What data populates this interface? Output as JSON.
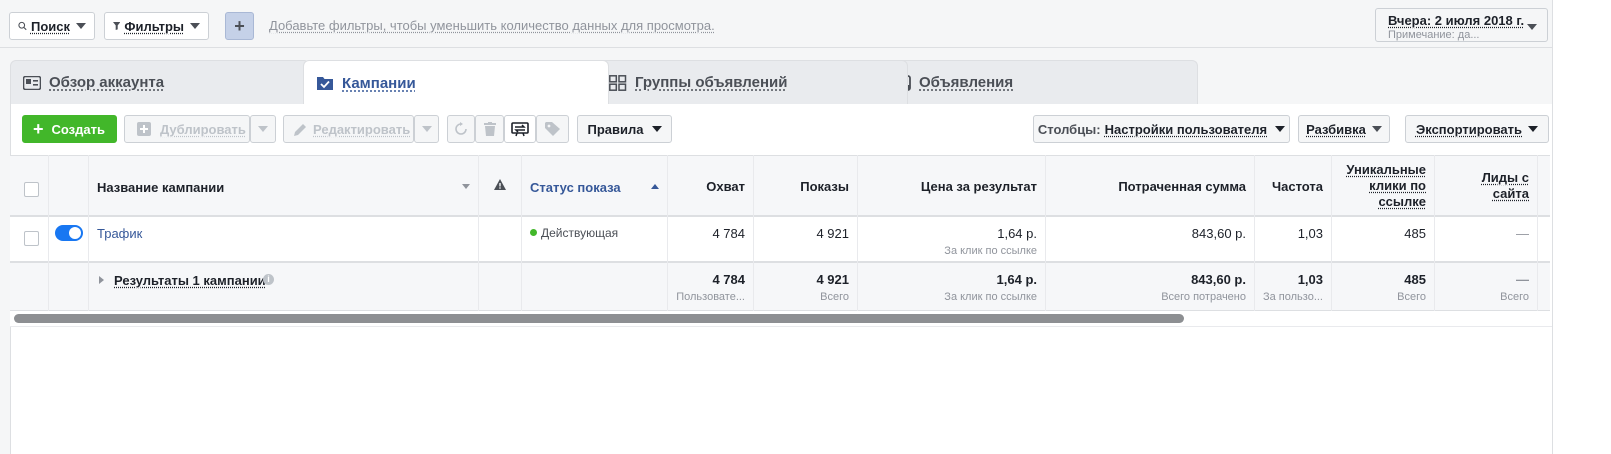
{
  "topbar": {
    "search_label": "Поиск",
    "filters_label": "Фильтры",
    "add_label": "+",
    "hint": "Добавьте фильтры, чтобы уменьшить количество данных для просмотра.",
    "date_label": "Вчера: 2 июля 2018 г.",
    "date_note": "Примечание: да..."
  },
  "tabs": [
    {
      "label": "Обзор аккаунта",
      "icon": "account-overview-icon"
    },
    {
      "label": "Кампании",
      "icon": "campaigns-icon"
    },
    {
      "label": "Группы объявлений",
      "icon": "ad-sets-icon"
    },
    {
      "label": "Объявления",
      "icon": "ads-icon"
    }
  ],
  "toolbar": {
    "create": "Создать",
    "duplicate": "Дублировать",
    "edit": "Редактировать",
    "rules": "Правила",
    "columns_prefix": "Столбцы:",
    "columns_value": "Настройки пользователя",
    "breakdown": "Разбивка",
    "export": "Экспортировать"
  },
  "columns": {
    "name": "Название кампании",
    "status": "Статус показа",
    "reach": "Охват",
    "impressions": "Показы",
    "cost": "Цена за результат",
    "spent": "Потраченная сумма",
    "frequency": "Частота",
    "unique_clicks": "Уникальные клики по ссылке",
    "leads": "Лиды с сайта"
  },
  "row": {
    "name": "Трафик",
    "status": "Действующая",
    "reach": "4 784",
    "impressions": "4 921",
    "cost": "1,64 р.",
    "cost_sub": "За клик по ссылке",
    "spent": "843,60 р.",
    "frequency": "1,03",
    "unique_clicks": "485",
    "leads": "—"
  },
  "totals": {
    "label": "Результаты 1 кампании",
    "reach": "4 784",
    "reach_sub": "Пользовате...",
    "impressions": "4 921",
    "impressions_sub": "Всего",
    "cost": "1,64 р.",
    "cost_sub": "За клик по ссылке",
    "spent": "843,60 р.",
    "spent_sub": "Всего потрачено",
    "frequency": "1,03",
    "frequency_sub": "За пользо...",
    "unique_clicks": "485",
    "unique_clicks_sub": "Всего",
    "leads": "—",
    "leads_sub": "Всего"
  },
  "colors": {
    "accent": "#365899",
    "create_green": "#42b72a",
    "toggle_blue": "#1877f2",
    "status_green": "#42b72a"
  }
}
